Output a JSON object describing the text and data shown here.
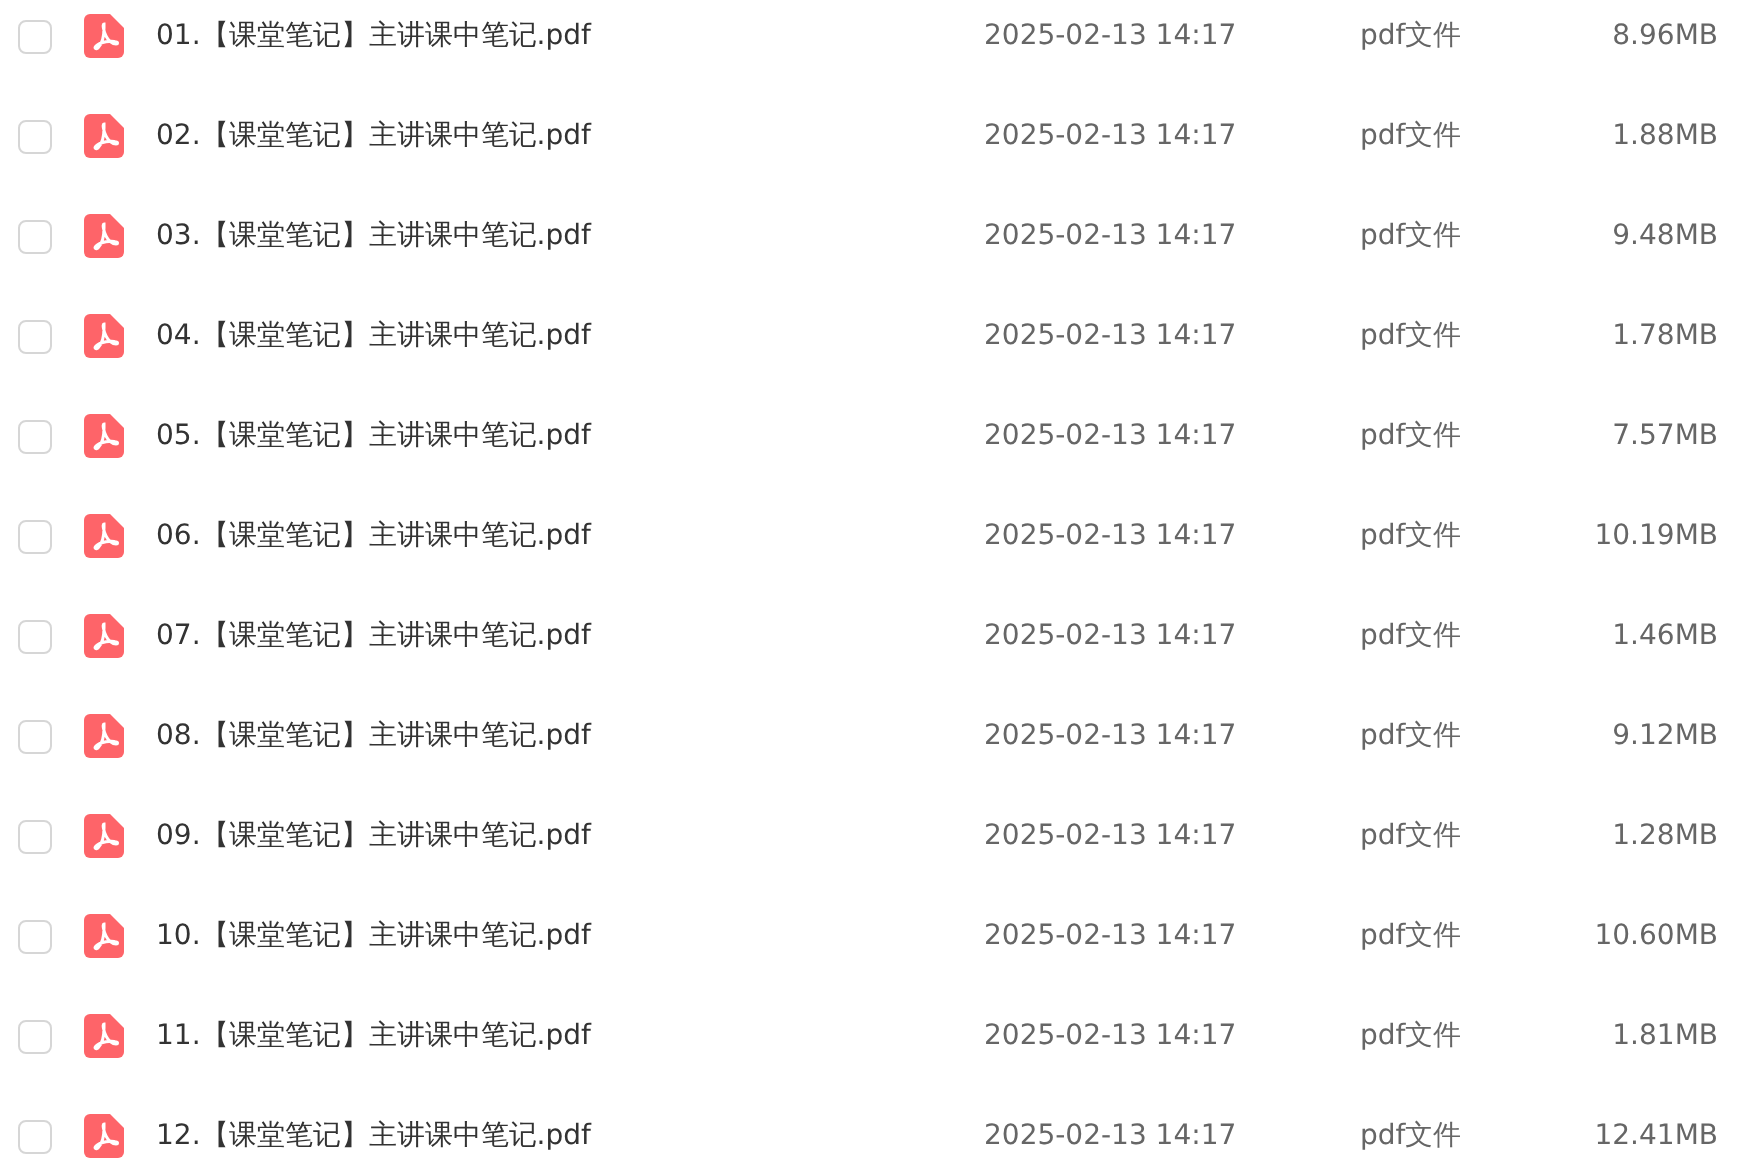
{
  "files": [
    {
      "name": "01.【课堂笔记】主讲课中笔记.pdf",
      "date": "2025-02-13 14:17",
      "type": "pdf文件",
      "size": "8.96MB",
      "checked": false
    },
    {
      "name": "02.【课堂笔记】主讲课中笔记.pdf",
      "date": "2025-02-13 14:17",
      "type": "pdf文件",
      "size": "1.88MB",
      "checked": false
    },
    {
      "name": "03.【课堂笔记】主讲课中笔记.pdf",
      "date": "2025-02-13 14:17",
      "type": "pdf文件",
      "size": "9.48MB",
      "checked": false
    },
    {
      "name": "04.【课堂笔记】主讲课中笔记.pdf",
      "date": "2025-02-13 14:17",
      "type": "pdf文件",
      "size": "1.78MB",
      "checked": false
    },
    {
      "name": "05.【课堂笔记】主讲课中笔记.pdf",
      "date": "2025-02-13 14:17",
      "type": "pdf文件",
      "size": "7.57MB",
      "checked": false
    },
    {
      "name": "06.【课堂笔记】主讲课中笔记.pdf",
      "date": "2025-02-13 14:17",
      "type": "pdf文件",
      "size": "10.19MB",
      "checked": false
    },
    {
      "name": "07.【课堂笔记】主讲课中笔记.pdf",
      "date": "2025-02-13 14:17",
      "type": "pdf文件",
      "size": "1.46MB",
      "checked": false
    },
    {
      "name": "08.【课堂笔记】主讲课中笔记.pdf",
      "date": "2025-02-13 14:17",
      "type": "pdf文件",
      "size": "9.12MB",
      "checked": false
    },
    {
      "name": "09.【课堂笔记】主讲课中笔记.pdf",
      "date": "2025-02-13 14:17",
      "type": "pdf文件",
      "size": "1.28MB",
      "checked": false
    },
    {
      "name": "10.【课堂笔记】主讲课中笔记.pdf",
      "date": "2025-02-13 14:17",
      "type": "pdf文件",
      "size": "10.60MB",
      "checked": false
    },
    {
      "name": "11.【课堂笔记】主讲课中笔记.pdf",
      "date": "2025-02-13 14:17",
      "type": "pdf文件",
      "size": "1.81MB",
      "checked": false
    },
    {
      "name": "12.【课堂笔记】主讲课中笔记.pdf",
      "date": "2025-02-13 14:17",
      "type": "pdf文件",
      "size": "12.41MB",
      "checked": false
    }
  ]
}
